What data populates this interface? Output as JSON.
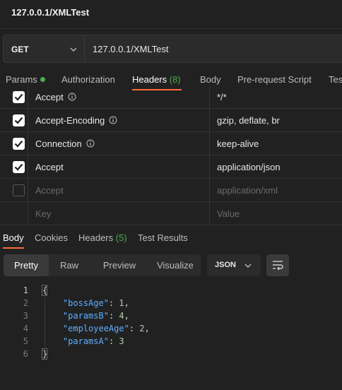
{
  "window": {
    "title": "127.0.0.1/XMLTest"
  },
  "request": {
    "method": "GET",
    "url": "127.0.0.1/XMLTest"
  },
  "request_tabs": [
    {
      "label": "Params",
      "count": ""
    },
    {
      "label": "Authorization",
      "count": ""
    },
    {
      "label": "Headers",
      "count": "(8)"
    },
    {
      "label": "Body",
      "count": ""
    },
    {
      "label": "Pre-request Script",
      "count": ""
    },
    {
      "label": "Tes",
      "count": ""
    }
  ],
  "headers_table": {
    "rows": [
      {
        "key": "Accept",
        "value": "*/*",
        "checked": true,
        "info": true
      },
      {
        "key": "Accept-Encoding",
        "value": "gzip, deflate, br",
        "checked": true,
        "info": true
      },
      {
        "key": "Connection",
        "value": "keep-alive",
        "checked": true,
        "info": true
      },
      {
        "key": "Accept",
        "value": "application/json",
        "checked": true,
        "info": false
      },
      {
        "key": "Accept",
        "value": "application/xml",
        "checked": false,
        "info": false
      }
    ],
    "new_row": {
      "key_placeholder": "Key",
      "value_placeholder": "Value"
    }
  },
  "response_tabs": [
    {
      "label": "Body",
      "count": ""
    },
    {
      "label": "Cookies",
      "count": ""
    },
    {
      "label": "Headers",
      "count": "(5)"
    },
    {
      "label": "Test Results",
      "count": ""
    }
  ],
  "view_modes": [
    "Pretty",
    "Raw",
    "Preview",
    "Visualize"
  ],
  "active_view": "Pretty",
  "format": "JSON",
  "response_body": {
    "line_numbers": [
      "1",
      "2",
      "3",
      "4",
      "5",
      "6"
    ],
    "open_brace": "{",
    "close_brace": "}",
    "entries": [
      {
        "key": "\"bossAge\"",
        "value": "1",
        "sep": ","
      },
      {
        "key": "\"paramsB\"",
        "value": "4",
        "sep": ","
      },
      {
        "key": "\"employeeAge\"",
        "value": "2",
        "sep": ","
      },
      {
        "key": "\"paramsA\"",
        "value": "3",
        "sep": ""
      }
    ]
  },
  "colors": {
    "accent": "#ff6c37",
    "success": "#4caf50",
    "json_key": "#5eb0ff",
    "json_number": "#b5cea8"
  }
}
